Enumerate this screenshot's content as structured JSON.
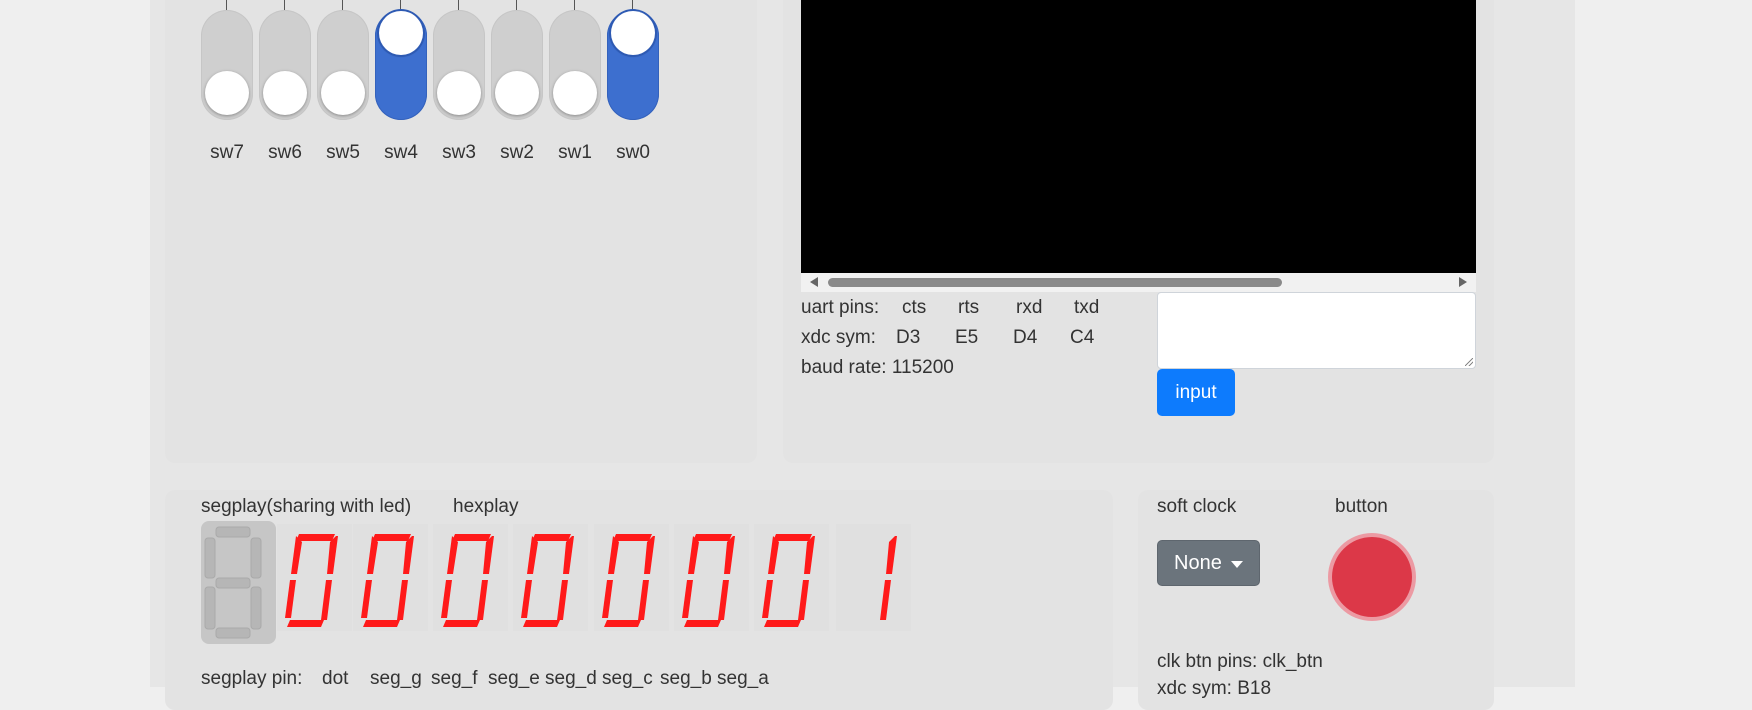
{
  "switches": [
    {
      "label": "sw7",
      "on": false
    },
    {
      "label": "sw6",
      "on": false
    },
    {
      "label": "sw5",
      "on": false
    },
    {
      "label": "sw4",
      "on": true
    },
    {
      "label": "sw3",
      "on": false
    },
    {
      "label": "sw2",
      "on": false
    },
    {
      "label": "sw1",
      "on": false
    },
    {
      "label": "sw0",
      "on": true
    }
  ],
  "uart": {
    "pins_label": "uart pins:",
    "pins": [
      "cts",
      "rts",
      "rxd",
      "txd"
    ],
    "xdc_label": "xdc sym:",
    "xdc": [
      "D3",
      "E5",
      "D4",
      "C4"
    ],
    "baud_text": "baud rate: 115200",
    "input_value": "",
    "input_button": "input"
  },
  "segplay": {
    "title": "segplay(sharing with led)",
    "hex_title": "hexplay",
    "digits": [
      "0",
      "0",
      "0",
      "0",
      "0",
      "0",
      "0",
      "1"
    ],
    "seg_color": "#ff1a1a",
    "pin_label": "segplay pin:",
    "pins": [
      "dot",
      "seg_g",
      "seg_f",
      "seg_e",
      "seg_d",
      "seg_c",
      "seg_b",
      "seg_a"
    ]
  },
  "clock": {
    "soft_clock_label": "soft clock",
    "button_label": "button",
    "select_value": "None",
    "clk_pins_text": "clk btn pins: clk_btn",
    "clk_pin_partial": "xdc sym: B18"
  },
  "icons": {
    "scroll_left": "arrow-left-icon",
    "scroll_right": "arrow-right-icon",
    "dropdown": "caret-down-icon"
  }
}
